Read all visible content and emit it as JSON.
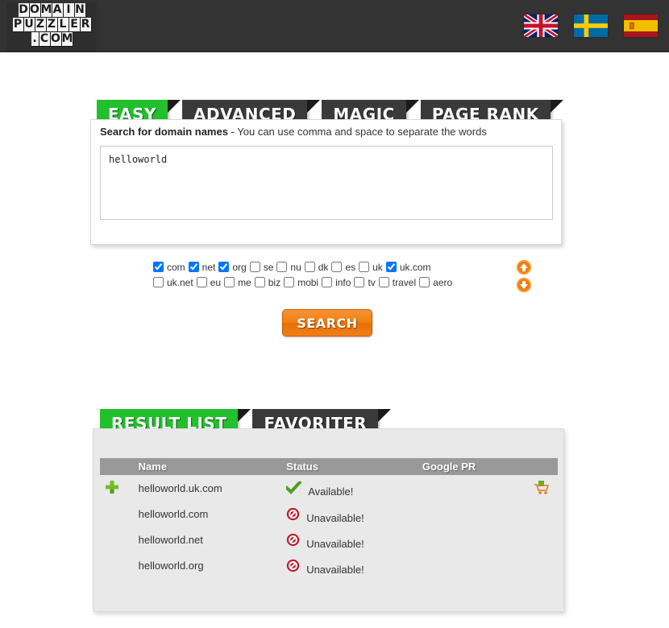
{
  "header": {
    "logo": {
      "line1": "DOMAIN",
      "line2": "PUZZLER",
      "line3": ".COM"
    },
    "flags": [
      {
        "name": "flag-uk",
        "label": "English"
      },
      {
        "name": "flag-sweden",
        "label": "Svenska"
      },
      {
        "name": "flag-spain",
        "label": "Espanol"
      }
    ]
  },
  "search_tabs": [
    {
      "label": "EASY",
      "active": true
    },
    {
      "label": "ADVANCED",
      "active": false
    },
    {
      "label": "MAGIC",
      "active": false
    },
    {
      "label": "PAGE RANK",
      "active": false
    }
  ],
  "search": {
    "label_bold": "Search for domain names",
    "label_rest": " - You can use comma and space to separate the words",
    "textarea_value": "helloworld",
    "textarea_placeholder": "",
    "button_label": "SEARCH"
  },
  "tlds": {
    "row1": [
      {
        "label": "com",
        "checked": true
      },
      {
        "label": "net",
        "checked": true
      },
      {
        "label": "org",
        "checked": true
      },
      {
        "label": "se",
        "checked": false
      },
      {
        "label": "nu",
        "checked": false
      },
      {
        "label": "dk",
        "checked": false
      },
      {
        "label": "es",
        "checked": false
      },
      {
        "label": "uk",
        "checked": false
      },
      {
        "label": "uk.com",
        "checked": true
      }
    ],
    "row2": [
      {
        "label": "uk.net",
        "checked": false
      },
      {
        "label": "eu",
        "checked": false
      },
      {
        "label": "me",
        "checked": false
      },
      {
        "label": "biz",
        "checked": false
      },
      {
        "label": "mobi",
        "checked": false
      },
      {
        "label": "info",
        "checked": false
      },
      {
        "label": "tv",
        "checked": false
      },
      {
        "label": "travel",
        "checked": false
      },
      {
        "label": "aero",
        "checked": false
      }
    ],
    "scroll_up_icon": "arrow-up-icon",
    "scroll_down_icon": "arrow-down-icon"
  },
  "result_tabs": [
    {
      "label": "RESULT LIST",
      "active": true
    },
    {
      "label": "FAVORITER",
      "active": false
    }
  ],
  "results": {
    "columns": [
      "",
      "Name",
      "Status",
      "Google PR",
      ""
    ],
    "rows": [
      {
        "add_icon": "plus-icon",
        "name": "helloworld.uk.com",
        "status_icon": "check-icon",
        "status": "Available!",
        "google_pr": "",
        "cart_icon": "cart-icon"
      },
      {
        "add_icon": "",
        "name": "helloworld.com",
        "status_icon": "blocked-icon",
        "status": "Unavailable!",
        "google_pr": "",
        "cart_icon": ""
      },
      {
        "add_icon": "",
        "name": "helloworld.net",
        "status_icon": "blocked-icon",
        "status": "Unavailable!",
        "google_pr": "",
        "cart_icon": ""
      },
      {
        "add_icon": "",
        "name": "helloworld.org",
        "status_icon": "blocked-icon",
        "status": "Unavailable!",
        "google_pr": "",
        "cart_icon": ""
      }
    ]
  },
  "colors": {
    "header_bg": "#333333",
    "tab_active": "#22c02c",
    "tab_inactive": "#3a3a3a",
    "accent_orange": "#ef7c0c",
    "panel_bg": "#e9e9e9",
    "table_header": "#999999",
    "available_green": "#4aa020",
    "unavailable_red": "#c0182a"
  }
}
